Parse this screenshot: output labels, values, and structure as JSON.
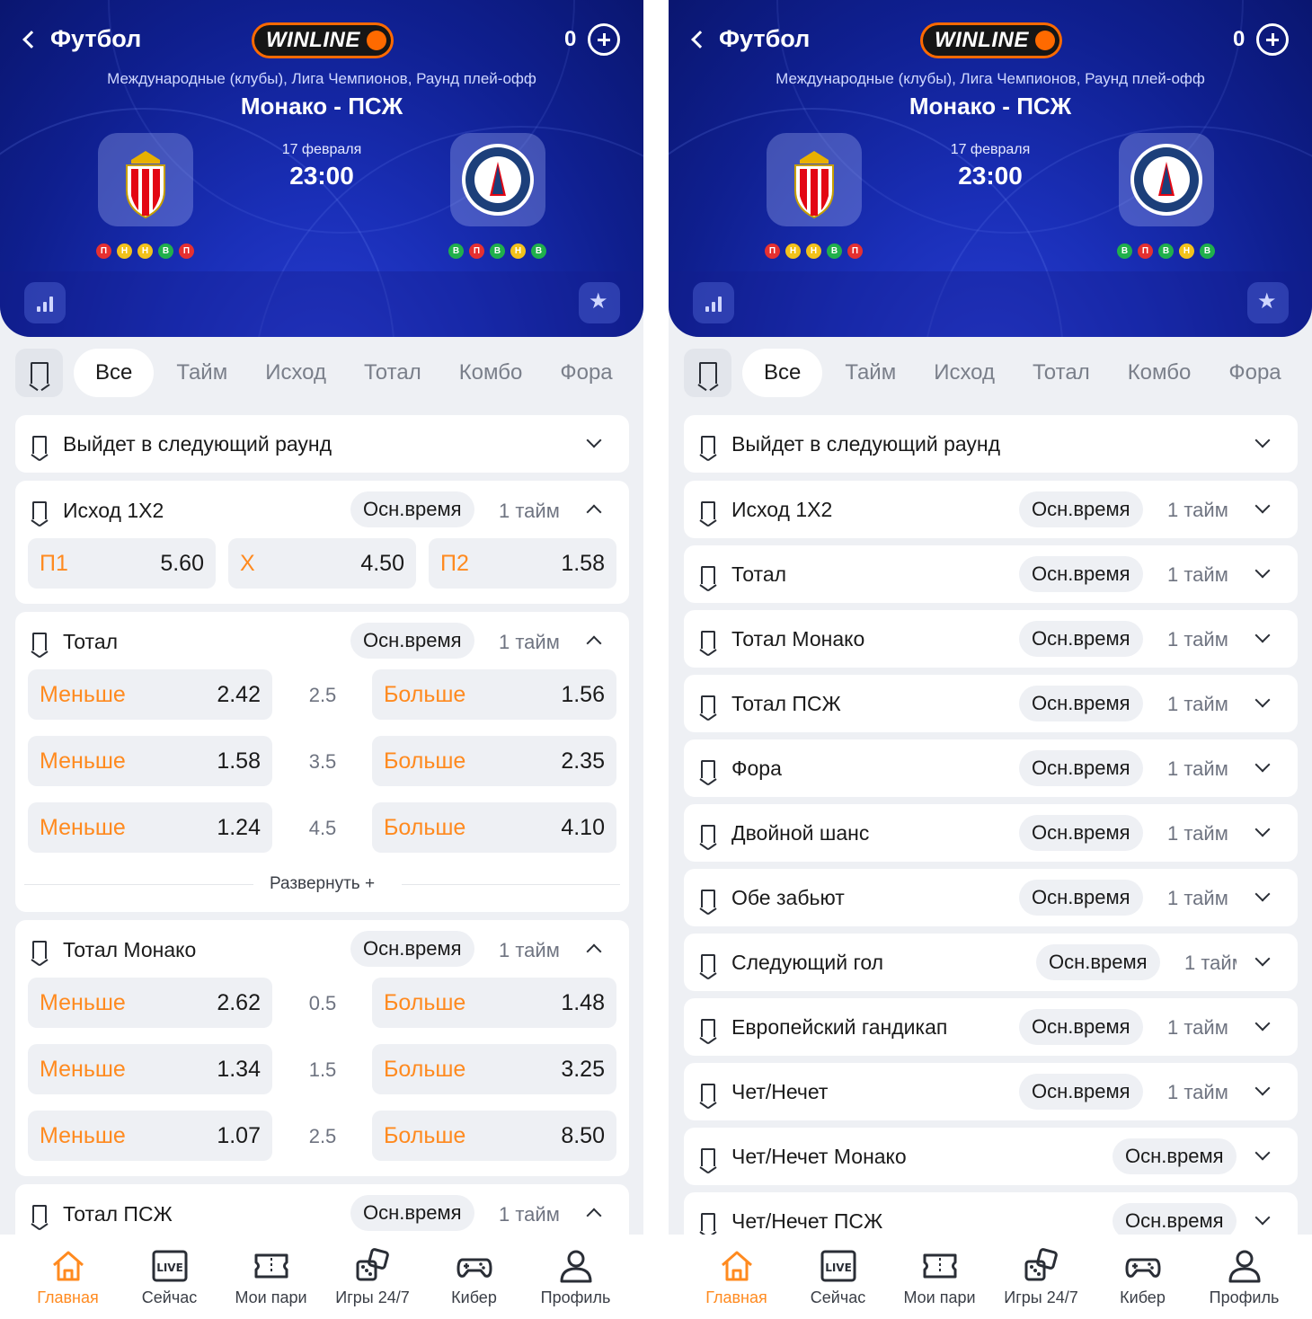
{
  "header": {
    "back_label": "Футбол",
    "logo_text": "WINLINE",
    "counter": "0",
    "league": "Международные (клубы), Лига Чемпионов, Раунд плей-офф",
    "match_title": "Монако - ПСЖ",
    "date": "17 февраля",
    "time": "23:00",
    "home_form": [
      "П",
      "Н",
      "Н",
      "В",
      "П"
    ],
    "away_form": [
      "В",
      "П",
      "В",
      "Н",
      "В"
    ]
  },
  "tabs": [
    "Все",
    "Тайм",
    "Исход",
    "Тотал",
    "Комбо",
    "Фора"
  ],
  "common": {
    "main_time": "Осн.время",
    "first_half": "1 тайм",
    "less": "Меньше",
    "more": "Больше",
    "expand": "Развернуть +"
  },
  "left": {
    "next_round": "Выйдет в следующий раунд",
    "outcome": {
      "title": "Исход 1X2",
      "odds": [
        {
          "label": "П1",
          "value": "5.60"
        },
        {
          "label": "X",
          "value": "4.50"
        },
        {
          "label": "П2",
          "value": "1.58"
        }
      ]
    },
    "total": {
      "title": "Тотал",
      "rows": [
        {
          "under": "2.42",
          "line": "2.5",
          "over": "1.56"
        },
        {
          "under": "1.58",
          "line": "3.5",
          "over": "2.35"
        },
        {
          "under": "1.24",
          "line": "4.5",
          "over": "4.10"
        }
      ]
    },
    "total_monaco": {
      "title": "Тотал Монако",
      "rows": [
        {
          "under": "2.62",
          "line": "0.5",
          "over": "1.48"
        },
        {
          "under": "1.34",
          "line": "1.5",
          "over": "3.25"
        },
        {
          "under": "1.07",
          "line": "2.5",
          "over": "8.50"
        }
      ]
    },
    "total_psg": {
      "title": "Тотал ПСЖ"
    }
  },
  "right": {
    "markets": [
      "Выйдет в следующий раунд",
      "Исход 1X2",
      "Тотал",
      "Тотал Монако",
      "Тотал ПСЖ",
      "Фора",
      "Двойной шанс",
      "Обе забьют",
      "Следующий гол",
      "Европейский гандикап",
      "Чет/Нечет",
      "Чет/Нечет Монако",
      "Чет/Нечет ПСЖ"
    ],
    "truncated_half": "1 тайм"
  },
  "nav": [
    "Главная",
    "Сейчас",
    "Мои пари",
    "Игры 24/7",
    "Кибер",
    "Профиль"
  ],
  "colors": {
    "accent": "#ff8a1f",
    "header_blue": "#1a2fb8",
    "win": "#20b04b",
    "loss": "#e53030",
    "draw": "#f2c21b"
  }
}
